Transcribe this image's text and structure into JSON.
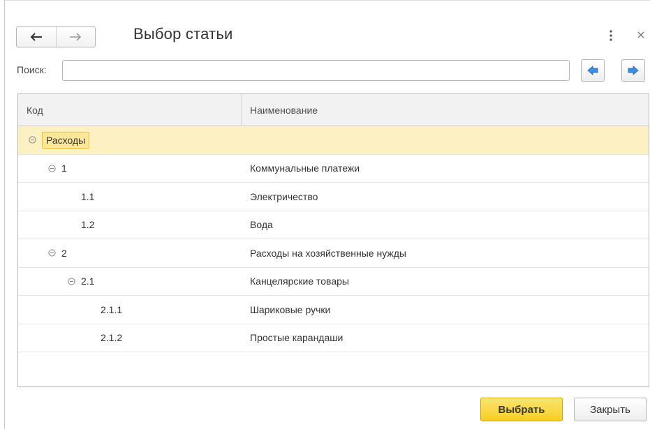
{
  "window": {
    "title": "Выбор статьи"
  },
  "search": {
    "label": "Поиск:",
    "value": "",
    "placeholder": ""
  },
  "table": {
    "columns": [
      "Код",
      "Наименование"
    ],
    "rows": [
      {
        "code": "Расходы",
        "name": "",
        "level": 0,
        "expanded": true,
        "selected": true
      },
      {
        "code": "1",
        "name": "Коммунальные платежи",
        "level": 1,
        "expanded": true,
        "selected": false
      },
      {
        "code": "1.1",
        "name": "Электричество",
        "level": 2,
        "expanded": null,
        "selected": false
      },
      {
        "code": "1.2",
        "name": "Вода",
        "level": 2,
        "expanded": null,
        "selected": false
      },
      {
        "code": "2",
        "name": "Расходы на хозяйственные нужды",
        "level": 1,
        "expanded": true,
        "selected": false
      },
      {
        "code": "2.1",
        "name": "Канцелярские товары",
        "level": 2,
        "expanded": true,
        "selected": false
      },
      {
        "code": "2.1.1",
        "name": "Шариковые ручки",
        "level": 3,
        "expanded": null,
        "selected": false
      },
      {
        "code": "2.1.2",
        "name": "Простые карандаши",
        "level": 3,
        "expanded": null,
        "selected": false
      }
    ]
  },
  "buttons": {
    "select_label": "Выбрать",
    "close_label": "Закрыть"
  },
  "colors": {
    "accent": "#f5cf24",
    "selection": "#fdf0c2",
    "arrow_blue": "#3a8ee6"
  },
  "icons": [
    "back-arrow-icon",
    "forward-arrow-icon",
    "more-vertical-icon",
    "close-icon",
    "find-previous-icon",
    "find-next-icon",
    "collapse-icon"
  ]
}
